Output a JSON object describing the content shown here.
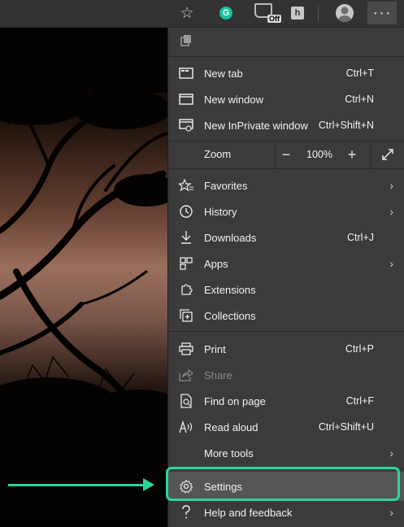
{
  "colors": {
    "menu_bg": "#3b3b3b",
    "toolbar_bg": "#333333",
    "highlight": "#2ad59a"
  },
  "toolbar": {
    "favorite_icon": "star-icon",
    "grammarly_letter": "G",
    "extension_badge": "Off",
    "extension_h_letter": "h",
    "more_label": "···"
  },
  "menu": {
    "items": [
      {
        "label": "New tab",
        "shortcut": "Ctrl+T",
        "icon": "new-tab-icon"
      },
      {
        "label": "New window",
        "shortcut": "Ctrl+N",
        "icon": "new-window-icon"
      },
      {
        "label": "New InPrivate window",
        "shortcut": "Ctrl+Shift+N",
        "icon": "inprivate-icon"
      },
      {
        "label": "Favorites",
        "icon": "favorites-icon"
      },
      {
        "label": "History",
        "icon": "history-icon"
      },
      {
        "label": "Downloads",
        "shortcut": "Ctrl+J",
        "icon": "download-icon"
      },
      {
        "label": "Apps",
        "icon": "apps-icon"
      },
      {
        "label": "Extensions",
        "icon": "extensions-icon"
      },
      {
        "label": "Collections",
        "icon": "collections-icon"
      },
      {
        "label": "Print",
        "shortcut": "Ctrl+P",
        "icon": "print-icon"
      },
      {
        "label": "Share",
        "icon": "share-icon"
      },
      {
        "label": "Find on page",
        "shortcut": "Ctrl+F",
        "icon": "find-icon"
      },
      {
        "label": "Read aloud",
        "shortcut": "Ctrl+Shift+U",
        "icon": "read-aloud-icon"
      },
      {
        "label": "More tools"
      },
      {
        "label": "Settings",
        "icon": "gear-icon"
      },
      {
        "label": "Help and feedback",
        "icon": "help-icon"
      }
    ],
    "zoom": {
      "label": "Zoom",
      "minus": "−",
      "value": "100%",
      "plus": "+"
    }
  }
}
